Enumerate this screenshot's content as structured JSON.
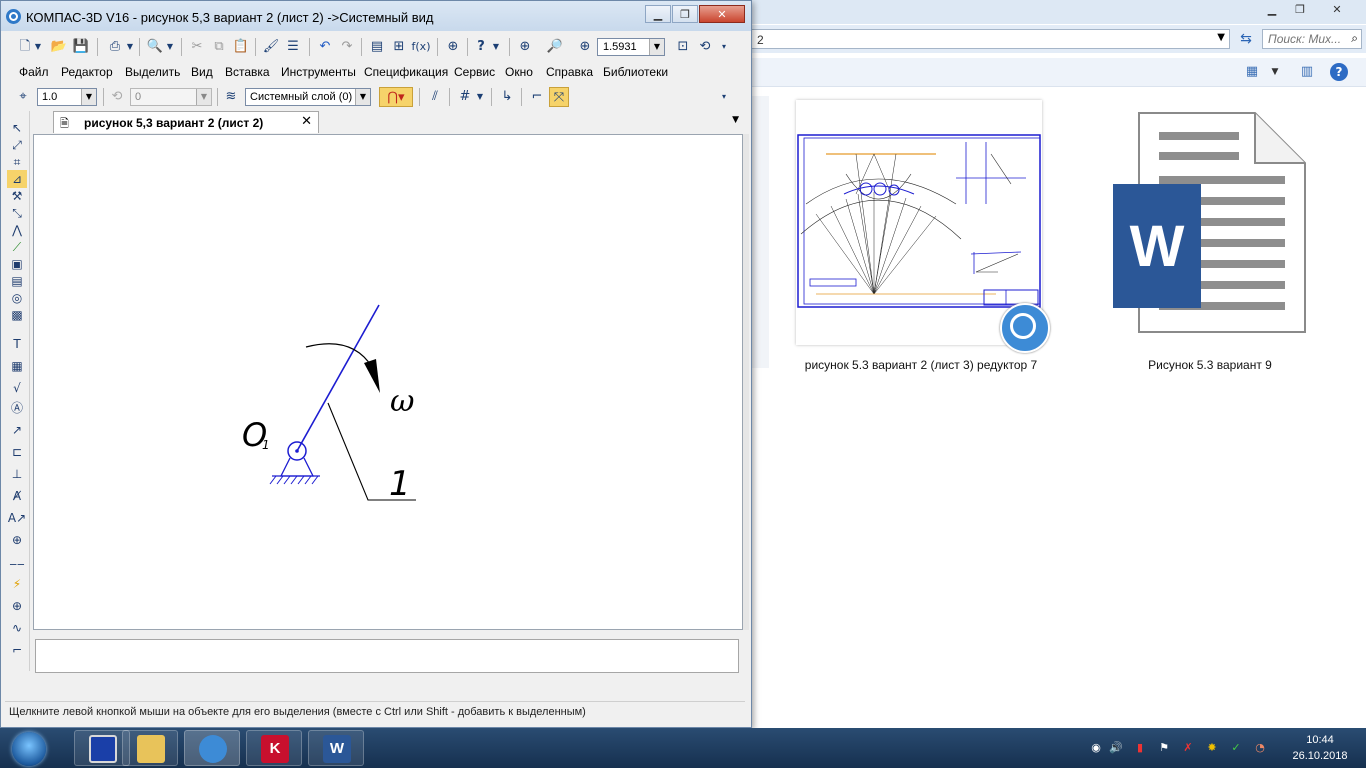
{
  "explorer": {
    "address_text": "2",
    "search_placeholder": "Поиск: Мих...",
    "files": [
      {
        "name": "рисунок 5.3 вариант 2 (лист 3) редуктор 7",
        "icon": "kompas-drawing-thumbnail"
      },
      {
        "name": "Рисунок 5.3 вариант 9",
        "icon": "word-document-icon"
      }
    ]
  },
  "kompas": {
    "title": "КОМПАС-3D V16  - рисунок 5,3 вариант 2 (лист 2) ->Системный вид",
    "zoom_value": "1.5931",
    "menu": [
      "Файл",
      "Редактор",
      "Выделить",
      "Вид",
      "Вставка",
      "Инструменты",
      "Спецификация",
      "Сервис",
      "Окно",
      "Справка",
      "Библиотеки"
    ],
    "step_value": "1.0",
    "angle_value": "0",
    "layer_value": "Системный слой (0)",
    "doc_tab_label": "рисунок 5,3 вариант 2 (лист 2)",
    "drawing": {
      "pivot_label": "O",
      "pivot_subscript": "1",
      "omega_label": "ω",
      "link_label": "1"
    },
    "status_text": "Щелкните левой кнопкой мыши на объекте для его выделения (вместе с Ctrl или Shift - добавить к выделенным)"
  },
  "taskbar": {
    "apps": [
      {
        "name": "floppy-save-app",
        "label": ""
      },
      {
        "name": "file-explorer",
        "label": ""
      },
      {
        "name": "kompas-3d",
        "label": ""
      },
      {
        "name": "kaspersky",
        "label": "K"
      },
      {
        "name": "microsoft-word",
        "label": "W"
      }
    ],
    "time": "10:44",
    "date": "26.10.2018"
  },
  "colors": {
    "drawing_blue": "#1d1dd1",
    "word_blue": "#2b5797",
    "kompas_blue": "#3d8bd6",
    "kaspersky_red": "#c8102e"
  }
}
